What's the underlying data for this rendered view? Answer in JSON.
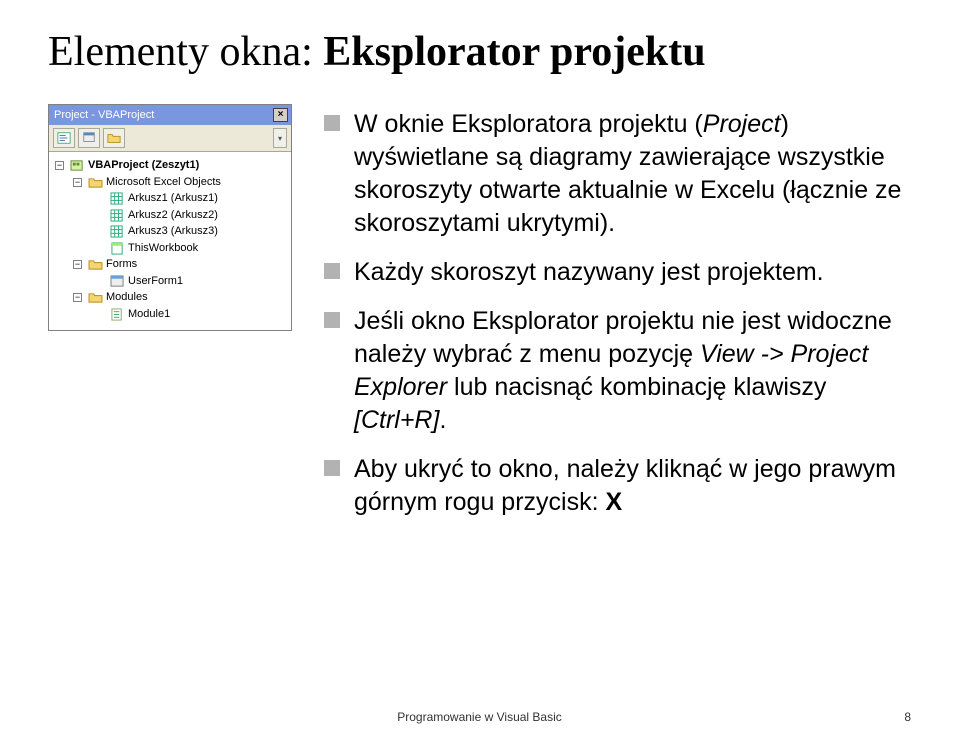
{
  "title_plain": "Elementy okna: ",
  "title_bold": "Eksplorator projektu",
  "explorer": {
    "titlebar": "Project - VBAProject",
    "close_glyph": "×",
    "toolbar_dd_glyph": "▾",
    "tree": {
      "root": "VBAProject (Zeszyt1)",
      "group_objects": "Microsoft Excel Objects",
      "sheets": [
        "Arkusz1 (Arkusz1)",
        "Arkusz2 (Arkusz2)",
        "Arkusz3 (Arkusz3)",
        "ThisWorkbook"
      ],
      "group_forms": "Forms",
      "form_items": [
        "UserForm1"
      ],
      "group_modules": "Modules",
      "module_items": [
        "Module1"
      ]
    }
  },
  "bullets": {
    "b1_pre": "W oknie Eksploratora projektu (",
    "b1_it": "Project",
    "b1_post": ") wyświetlane są diagramy zawierające wszystkie skoroszyty otwarte aktualnie w Excelu (łącznie ze skoroszytami ukrytymi).",
    "b2": "Każdy skoroszyt nazywany jest projektem.",
    "b3_pre": "Jeśli okno Eksplorator projektu nie jest widoczne należy wybrać z menu pozycję ",
    "b3_it": "View -> Project Explorer",
    "b3_mid": " lub nacisnąć kombinację klawiszy ",
    "b3_it2": "[Ctrl+R]",
    "b3_post": ".",
    "b4_pre": "Aby ukryć to okno, należy kliknąć w jego prawym górnym rogu przycisk: ",
    "b4_bold": "X"
  },
  "footer": "Programowanie w Visual Basic",
  "page_number": "8"
}
